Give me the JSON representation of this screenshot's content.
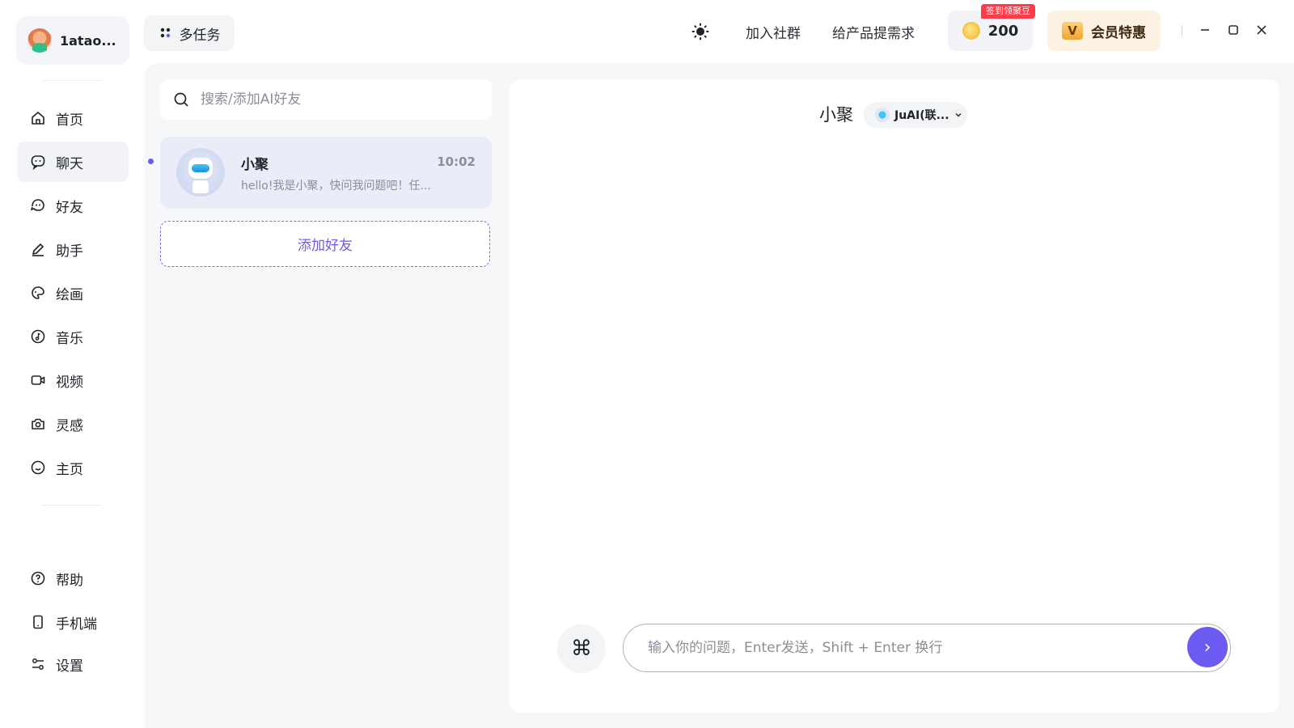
{
  "user": {
    "name": "1atao..."
  },
  "nav": [
    {
      "label": "首页",
      "icon": "home-icon"
    },
    {
      "label": "聊天",
      "icon": "chat-icon",
      "active": true
    },
    {
      "label": "好友",
      "icon": "friends-icon"
    },
    {
      "label": "助手",
      "icon": "pen-icon"
    },
    {
      "label": "绘画",
      "icon": "palette-icon"
    },
    {
      "label": "音乐",
      "icon": "music-icon"
    },
    {
      "label": "视频",
      "icon": "video-icon"
    },
    {
      "label": "灵感",
      "icon": "camera-icon"
    },
    {
      "label": "主页",
      "icon": "smile-icon"
    }
  ],
  "bottom_nav": [
    {
      "label": "帮助",
      "icon": "help-icon"
    },
    {
      "label": "手机端",
      "icon": "phone-icon"
    },
    {
      "label": "设置",
      "icon": "settings-icon"
    }
  ],
  "topbar": {
    "multitask_label": "多任务",
    "join_group": "加入社群",
    "feedback": "给产品提需求",
    "coins": "200",
    "checkin_badge": "签到领聚豆",
    "vip_label": "会员特惠",
    "vip_icon_letter": "V"
  },
  "search": {
    "placeholder": "搜索/添加AI好友"
  },
  "chat_list": [
    {
      "name": "小聚",
      "time": "10:02",
      "preview": "hello!我是小聚，快问我问题吧！任..."
    }
  ],
  "add_friend_label": "添加好友",
  "chat": {
    "title": "小聚",
    "model": "JuAI(联...",
    "input_placeholder": "输入你的问题，Enter发送，Shift + Enter 换行",
    "cmd_symbol": "⌘",
    "send_symbol": "›"
  },
  "colors": {
    "accent": "#6b5bf0",
    "badge": "#ff3b4a",
    "vip_bg": "#fdf2e1"
  }
}
